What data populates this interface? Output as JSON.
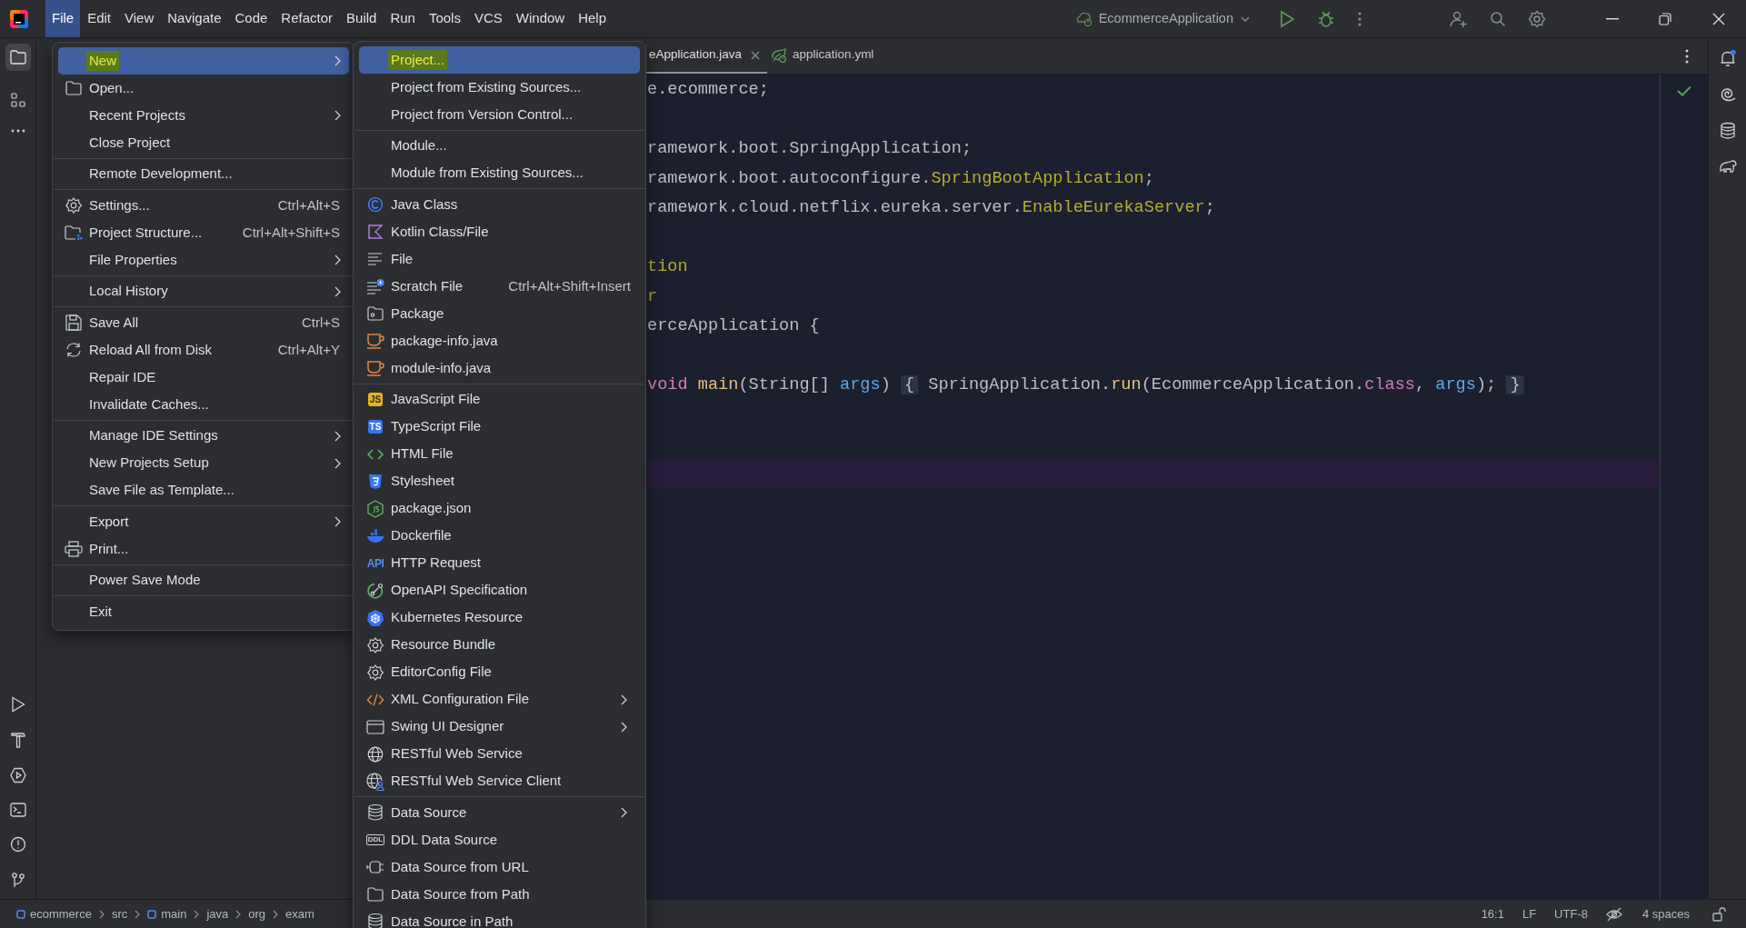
{
  "menu_bar": [
    {
      "label": "File",
      "selected": true
    },
    {
      "label": "Edit",
      "selected": false
    },
    {
      "label": "View",
      "selected": false
    },
    {
      "label": "Navigate",
      "selected": false
    },
    {
      "label": "Code",
      "selected": false
    },
    {
      "label": "Refactor",
      "selected": false
    },
    {
      "label": "Build",
      "selected": false
    },
    {
      "label": "Run",
      "selected": false
    },
    {
      "label": "Tools",
      "selected": false
    },
    {
      "label": "VCS",
      "selected": false
    },
    {
      "label": "Window",
      "selected": false
    },
    {
      "label": "Help",
      "selected": false
    }
  ],
  "run_configuration": {
    "label": "EcommerceApplication"
  },
  "editor_tabs": [
    {
      "label": "eApplication.java",
      "selected": true,
      "closable": true
    },
    {
      "label": "application.yml",
      "selected": false,
      "closable": false
    }
  ],
  "code_lines": [
    {
      "kind": "code",
      "tokens": [
        {
          "text": "e.ecommerce;",
          "kind": "plain"
        }
      ]
    },
    {
      "kind": "blank"
    },
    {
      "kind": "code",
      "tokens": [
        {
          "text": "ramework.boot.SpringApplication;",
          "kind": "plain"
        }
      ]
    },
    {
      "kind": "code",
      "tokens": [
        {
          "text": "ramework.boot.autoconfigure.",
          "kind": "plain"
        },
        {
          "text": "SpringBootApplication",
          "kind": "annotation"
        },
        {
          "text": ";",
          "kind": "plain"
        }
      ]
    },
    {
      "kind": "code",
      "tokens": [
        {
          "text": "ramework.cloud.netflix.eureka.server.",
          "kind": "plain"
        },
        {
          "text": "EnableEurekaServer",
          "kind": "annotation"
        },
        {
          "text": ";",
          "kind": "plain"
        }
      ]
    },
    {
      "kind": "blank"
    },
    {
      "kind": "code",
      "tokens": [
        {
          "text": "tion",
          "kind": "annotation"
        }
      ]
    },
    {
      "kind": "code",
      "tokens": [
        {
          "text": "r",
          "kind": "annotation"
        }
      ]
    },
    {
      "kind": "code",
      "tokens": [
        {
          "text": "erceApplication {",
          "kind": "plain"
        }
      ]
    },
    {
      "kind": "blank"
    },
    {
      "kind": "code",
      "tokens": [
        {
          "text": "void ",
          "kind": "keyword"
        },
        {
          "text": "main",
          "kind": "method"
        },
        {
          "text": "(String[] ",
          "kind": "plain"
        },
        {
          "text": "args",
          "kind": "param"
        },
        {
          "text": ") ",
          "kind": "plain"
        },
        {
          "text": "{",
          "kind": "fold"
        },
        {
          "text": " SpringApplication.",
          "kind": "plain"
        },
        {
          "text": "run",
          "kind": "method"
        },
        {
          "text": "(EcommerceApplication.",
          "kind": "plain"
        },
        {
          "text": "class",
          "kind": "keyword2"
        },
        {
          "text": ", ",
          "kind": "plain"
        },
        {
          "text": "args",
          "kind": "param"
        },
        {
          "text": "); ",
          "kind": "plain"
        },
        {
          "text": "}",
          "kind": "fold"
        }
      ]
    },
    {
      "kind": "blank"
    },
    {
      "kind": "blank"
    },
    {
      "kind": "current_line"
    }
  ],
  "file_menu": [
    {
      "kind": "item",
      "label": "New",
      "has_submenu": true,
      "selected": true,
      "marked": true
    },
    {
      "kind": "item",
      "label": "Open...",
      "has_submenu": false,
      "selected": false,
      "marked": false
    },
    {
      "kind": "item",
      "label": "Recent Projects",
      "has_submenu": true,
      "selected": false,
      "marked": false
    },
    {
      "kind": "item",
      "label": "Close Project",
      "has_submenu": false,
      "selected": false,
      "marked": false
    },
    {
      "kind": "separator"
    },
    {
      "kind": "item",
      "label": "Remote Development...",
      "has_submenu": false,
      "selected": false,
      "marked": false
    },
    {
      "kind": "separator"
    },
    {
      "kind": "item",
      "label": "Settings...",
      "shortcut": "Ctrl+Alt+S",
      "has_submenu": false,
      "selected": false,
      "marked": false
    },
    {
      "kind": "item",
      "label": "Project Structure...",
      "shortcut": "Ctrl+Alt+Shift+S",
      "has_submenu": false,
      "selected": false,
      "marked": false
    },
    {
      "kind": "item",
      "label": "File Properties",
      "has_submenu": true,
      "selected": false,
      "marked": false
    },
    {
      "kind": "separator"
    },
    {
      "kind": "item",
      "label": "Local History",
      "has_submenu": true,
      "selected": false,
      "marked": false
    },
    {
      "kind": "separator"
    },
    {
      "kind": "item",
      "label": "Save All",
      "shortcut": "Ctrl+S",
      "has_submenu": false,
      "selected": false,
      "marked": false
    },
    {
      "kind": "item",
      "label": "Reload All from Disk",
      "shortcut": "Ctrl+Alt+Y",
      "has_submenu": false,
      "selected": false,
      "marked": false
    },
    {
      "kind": "item",
      "label": "Repair IDE",
      "has_submenu": false,
      "selected": false,
      "marked": false
    },
    {
      "kind": "item",
      "label": "Invalidate Caches...",
      "has_submenu": false,
      "selected": false,
      "marked": false
    },
    {
      "kind": "separator"
    },
    {
      "kind": "item",
      "label": "Manage IDE Settings",
      "has_submenu": true,
      "selected": false,
      "marked": false
    },
    {
      "kind": "item",
      "label": "New Projects Setup",
      "has_submenu": true,
      "selected": false,
      "marked": false
    },
    {
      "kind": "item",
      "label": "Save File as Template...",
      "has_submenu": false,
      "selected": false,
      "marked": false
    },
    {
      "kind": "separator"
    },
    {
      "kind": "item",
      "label": "Export",
      "has_submenu": true,
      "selected": false,
      "marked": false
    },
    {
      "kind": "item",
      "label": "Print...",
      "has_submenu": false,
      "selected": false,
      "marked": false
    },
    {
      "kind": "separator"
    },
    {
      "kind": "item",
      "label": "Power Save Mode",
      "has_submenu": false,
      "selected": false,
      "marked": false
    },
    {
      "kind": "separator"
    },
    {
      "kind": "item",
      "label": "Exit",
      "has_submenu": false,
      "selected": false,
      "marked": false
    }
  ],
  "new_submenu": [
    {
      "kind": "item",
      "label": "Project...",
      "has_submenu": false,
      "selected": true,
      "marked": true
    },
    {
      "kind": "item",
      "label": "Project from Existing Sources...",
      "has_submenu": false,
      "selected": false,
      "marked": false
    },
    {
      "kind": "item",
      "label": "Project from Version Control...",
      "has_submenu": false,
      "selected": false,
      "marked": false
    },
    {
      "kind": "separator"
    },
    {
      "kind": "item",
      "label": "Module...",
      "has_submenu": false,
      "selected": false,
      "marked": false
    },
    {
      "kind": "item",
      "label": "Module from Existing Sources...",
      "has_submenu": false,
      "selected": false,
      "marked": false
    },
    {
      "kind": "separator"
    },
    {
      "kind": "item",
      "label": "Java Class",
      "has_submenu": false,
      "selected": false,
      "marked": false
    },
    {
      "kind": "item",
      "label": "Kotlin Class/File",
      "has_submenu": false,
      "selected": false,
      "marked": false
    },
    {
      "kind": "item",
      "label": "File",
      "has_submenu": false,
      "selected": false,
      "marked": false
    },
    {
      "kind": "item",
      "label": "Scratch File",
      "shortcut": "Ctrl+Alt+Shift+Insert",
      "has_submenu": false,
      "selected": false,
      "marked": false
    },
    {
      "kind": "item",
      "label": "Package",
      "has_submenu": false,
      "selected": false,
      "marked": false
    },
    {
      "kind": "item",
      "label": "package-info.java",
      "has_submenu": false,
      "selected": false,
      "marked": false
    },
    {
      "kind": "item",
      "label": "module-info.java",
      "has_submenu": false,
      "selected": false,
      "marked": false
    },
    {
      "kind": "separator"
    },
    {
      "kind": "item",
      "label": "JavaScript File",
      "icon_text": "JS",
      "has_submenu": false,
      "selected": false,
      "marked": false
    },
    {
      "kind": "item",
      "label": "TypeScript File",
      "icon_text": "TS",
      "has_submenu": false,
      "selected": false,
      "marked": false
    },
    {
      "kind": "item",
      "label": "HTML File",
      "has_submenu": false,
      "selected": false,
      "marked": false
    },
    {
      "kind": "item",
      "label": "Stylesheet",
      "has_submenu": false,
      "selected": false,
      "marked": false
    },
    {
      "kind": "item",
      "label": "package.json",
      "has_submenu": false,
      "selected": false,
      "marked": false
    },
    {
      "kind": "item",
      "label": "Dockerfile",
      "has_submenu": false,
      "selected": false,
      "marked": false
    },
    {
      "kind": "item",
      "label": "HTTP Request",
      "icon_text": "API",
      "has_submenu": false,
      "selected": false,
      "marked": false
    },
    {
      "kind": "item",
      "label": "OpenAPI Specification",
      "has_submenu": false,
      "selected": false,
      "marked": false
    },
    {
      "kind": "item",
      "label": "Kubernetes Resource",
      "has_submenu": false,
      "selected": false,
      "marked": false
    },
    {
      "kind": "item",
      "label": "Resource Bundle",
      "has_submenu": false,
      "selected": false,
      "marked": false
    },
    {
      "kind": "item",
      "label": "EditorConfig File",
      "has_submenu": false,
      "selected": false,
      "marked": false
    },
    {
      "kind": "item",
      "label": "XML Configuration File",
      "has_submenu": true,
      "selected": false,
      "marked": false
    },
    {
      "kind": "item",
      "label": "Swing UI Designer",
      "has_submenu": true,
      "selected": false,
      "marked": false
    },
    {
      "kind": "item",
      "label": "RESTful Web Service",
      "has_submenu": false,
      "selected": false,
      "marked": false
    },
    {
      "kind": "item",
      "label": "RESTful Web Service Client",
      "has_submenu": false,
      "selected": false,
      "marked": false
    },
    {
      "kind": "separator"
    },
    {
      "kind": "item",
      "label": "Data Source",
      "has_submenu": true,
      "selected": false,
      "marked": false
    },
    {
      "kind": "item",
      "label": "DDL Data Source",
      "icon_text": "DDL",
      "has_submenu": false,
      "selected": false,
      "marked": false
    },
    {
      "kind": "item",
      "label": "Data Source from URL",
      "has_submenu": false,
      "selected": false,
      "marked": false
    },
    {
      "kind": "item",
      "label": "Data Source from Path",
      "has_submenu": false,
      "selected": false,
      "marked": false
    },
    {
      "kind": "item",
      "label": "Data Source in Path",
      "has_submenu": false,
      "selected": false,
      "marked": false
    }
  ],
  "breadcrumbs": [
    {
      "label": "ecommerce",
      "kind": "module"
    },
    {
      "label": "src",
      "kind": "folder"
    },
    {
      "label": "main",
      "kind": "module"
    },
    {
      "label": "java",
      "kind": "folder"
    },
    {
      "label": "org",
      "kind": "folder"
    },
    {
      "label": "exam",
      "kind": "folder"
    }
  ],
  "status_bar": {
    "position": "16:1",
    "line_separator": "LF",
    "encoding": "UTF-8",
    "indent": "4 spaces"
  }
}
